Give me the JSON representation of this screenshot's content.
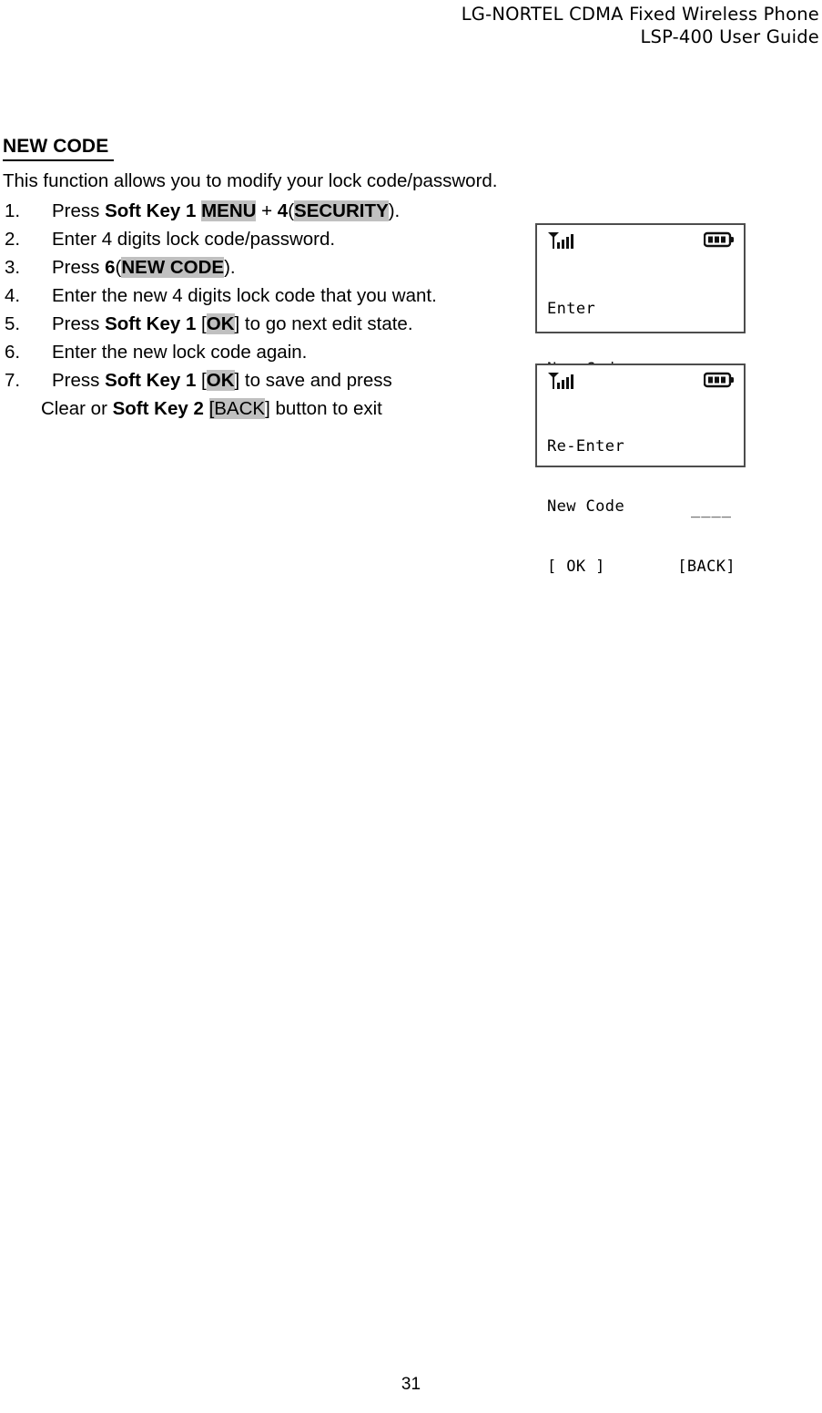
{
  "header": {
    "line1": "LG-NORTEL CDMA Fixed Wireless Phone",
    "line2": "LSP-400 User Guide"
  },
  "section": {
    "title": "NEW CODE ",
    "intro": "This function allows you to modify your lock code/password."
  },
  "steps": [
    {
      "num": "1.",
      "parts": [
        {
          "t": "Press ",
          "bold": false,
          "hl": false
        },
        {
          "t": "Soft Key 1 ",
          "bold": true,
          "hl": false
        },
        {
          "t": "MENU",
          "bold": true,
          "hl": true
        },
        {
          "t": " + ",
          "bold": false,
          "hl": false
        },
        {
          "t": "4",
          "bold": true,
          "hl": false
        },
        {
          "t": "(",
          "bold": false,
          "hl": false
        },
        {
          "t": "SECURITY",
          "bold": true,
          "hl": true
        },
        {
          "t": ").",
          "bold": false,
          "hl": false
        }
      ]
    },
    {
      "num": "2.",
      "parts": [
        {
          "t": "Enter 4 digits lock code/password.",
          "bold": false,
          "hl": false
        }
      ]
    },
    {
      "num": "3.",
      "parts": [
        {
          "t": "Press ",
          "bold": false,
          "hl": false
        },
        {
          "t": "6",
          "bold": true,
          "hl": false
        },
        {
          "t": "(",
          "bold": false,
          "hl": false
        },
        {
          "t": "NEW CODE",
          "bold": true,
          "hl": true
        },
        {
          "t": ").",
          "bold": false,
          "hl": false
        }
      ]
    },
    {
      "num": "4.",
      "parts": [
        {
          "t": "Enter the new 4 digits lock code that you want.",
          "bold": false,
          "hl": false
        }
      ]
    },
    {
      "num": "5.",
      "parts": [
        {
          "t": "Press ",
          "bold": false,
          "hl": false
        },
        {
          "t": "Soft Key 1",
          "bold": true,
          "hl": false
        },
        {
          "t": " [",
          "bold": false,
          "hl": false
        },
        {
          "t": "OK",
          "bold": true,
          "hl": true
        },
        {
          "t": "] to go next edit state.",
          "bold": false,
          "hl": false
        }
      ]
    },
    {
      "num": "6.",
      "parts": [
        {
          "t": "Enter the new lock code again.",
          "bold": false,
          "hl": false
        }
      ]
    },
    {
      "num": "7.",
      "parts": [
        {
          "t": "Press ",
          "bold": false,
          "hl": false
        },
        {
          "t": "Soft Key 1",
          "bold": true,
          "hl": false
        },
        {
          "t": " [",
          "bold": false,
          "hl": false
        },
        {
          "t": "OK",
          "bold": true,
          "hl": true
        },
        {
          "t": "] to save and press",
          "bold": false,
          "hl": false
        }
      ]
    },
    {
      "num": "",
      "continuation": true,
      "parts": [
        {
          "t": "Clear or ",
          "bold": false,
          "hl": false
        },
        {
          "t": "Soft Key 2",
          "bold": true,
          "hl": false
        },
        {
          "t": " ",
          "bold": false,
          "hl": false
        },
        {
          "t": "[BACK",
          "bold": false,
          "hl": true
        },
        {
          "t": "] button to exit",
          "bold": false,
          "hl": false
        }
      ]
    }
  ],
  "screens": [
    {
      "id": "enter-new-code",
      "signal_icon": "signal-bars-icon",
      "battery_icon": "battery-icon",
      "line1": "Enter",
      "line2": "New Code",
      "input_placeholder": "____",
      "softkey_left": "[ OK ]",
      "softkey_right": "[BACK]"
    },
    {
      "id": "re-enter-new-code",
      "signal_icon": "signal-bars-icon",
      "battery_icon": "battery-icon",
      "line1": "Re-Enter",
      "line2": "New Code",
      "input_placeholder": "____",
      "softkey_left": "[ OK ]",
      "softkey_right": "[BACK]"
    }
  ],
  "footer": {
    "page_number": "31"
  },
  "colors": {
    "highlight": "#c0c0c0",
    "lcd_border": "#4d4d4d",
    "text": "#000000"
  }
}
